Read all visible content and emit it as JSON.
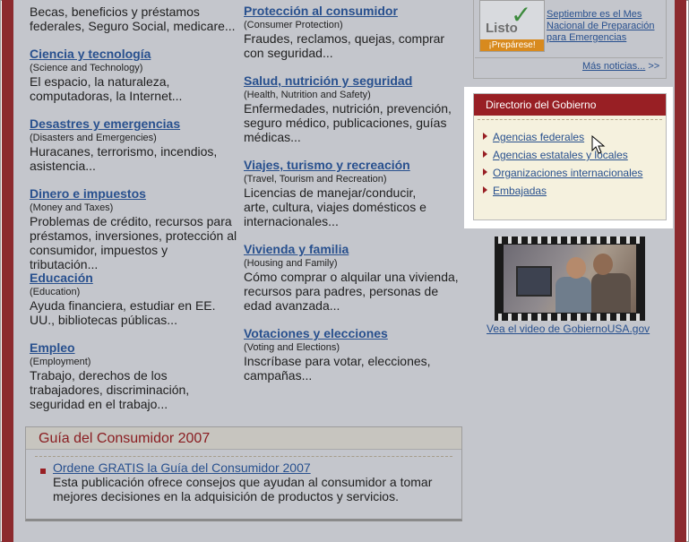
{
  "top_fragment": "Becas, beneficios y préstamos federales, Seguro Social, medicare...",
  "left_topics": [
    {
      "title": "Ciencia y tecnología",
      "english": "(Science and Technology)",
      "desc": "El espacio, la naturaleza, computadoras, la Internet..."
    },
    {
      "title": "Desastres y emergencias",
      "english": "(Disasters and Emergencies)",
      "desc": "Huracanes, terrorismo, incendios, asistencia..."
    },
    {
      "title": "Dinero e impuestos",
      "english": "(Money and Taxes)",
      "desc": "Problemas de crédito, recursos para préstamos, inversiones, protección al consumidor, impuestos y tributación..."
    },
    {
      "title": "Educación",
      "english": "(Education)",
      "desc": "Ayuda financiera, estudiar en EE. UU., bibliotecas públicas..."
    },
    {
      "title": "Empleo",
      "english": "(Employment)",
      "desc": "Trabajo, derechos de los trabajadores, discriminación, seguridad en el trabajo..."
    }
  ],
  "right_topics": [
    {
      "title": "Protección al consumidor",
      "english": "(Consumer Protection)",
      "desc": "Fraudes, reclamos, quejas, comprar con seguridad..."
    },
    {
      "title": "Salud, nutrición y seguridad",
      "english": "(Health, Nutrition and Safety)",
      "desc": "Enfermedades, nutrición, prevención, seguro médico, publicaciones, guías médicas..."
    },
    {
      "title": "Viajes, turismo y recreación",
      "english": "(Travel, Tourism and Recreation)",
      "desc": "Licencias de manejar/conducir, arte, cultura, viajes domésticos e internacionales..."
    },
    {
      "title": "Vivienda y familia",
      "english": "(Housing and Family)",
      "desc": "Cómo comprar o alquilar una vivienda, recursos para padres, personas de edad avanzada..."
    },
    {
      "title": "Votaciones y elecciones",
      "english": "(Voting and Elections)",
      "desc": "Inscríbase para votar, elecciones, campañas..."
    }
  ],
  "news": {
    "listo_label": "Listo",
    "listo_badge": "¡Prepárese!",
    "link": "Septiembre es el Mes Nacional de Preparación para Emergencias",
    "more": "Más noticias...",
    "more_arrow": ">>"
  },
  "directory": {
    "title": "Directorio del Gobierno",
    "items": [
      "Agencias federales",
      "Agencias estatales y locales",
      "Organizaciones internacionales",
      "Embajadas"
    ]
  },
  "video": {
    "caption": "Vea el video de GobiernoUSA.gov"
  },
  "guide": {
    "title": "Guía del Consumidor 2007",
    "link": "Ordene GRATIS la Guía del Consumidor 2007",
    "desc": "Esta publicación ofrece consejos que ayudan al consumidor a tomar mejores decisiones en la adquisición de productos y servicios."
  },
  "colors": {
    "accent_red": "#981f24",
    "link_blue": "#28508e",
    "page_gray": "#c4c6cc",
    "panel_cream": "#f5f1de"
  }
}
